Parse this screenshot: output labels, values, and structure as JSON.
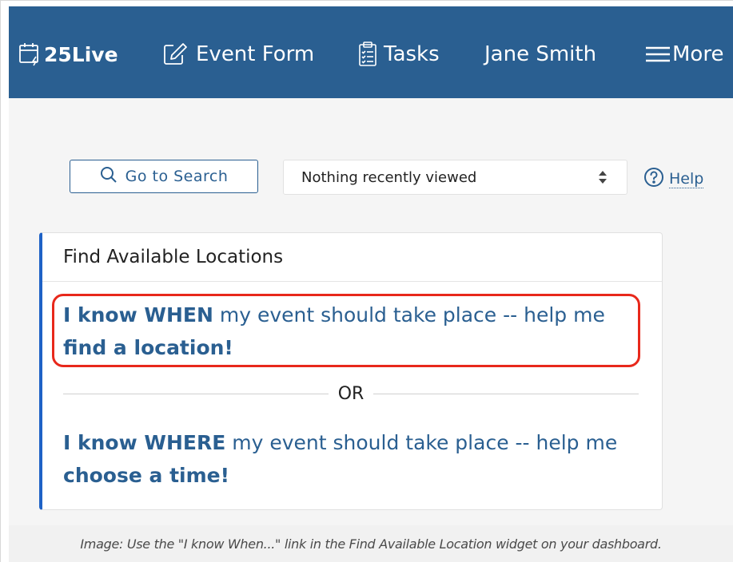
{
  "nav": {
    "brand": "25Live",
    "event_form": "Event Form",
    "tasks": "Tasks",
    "user": "Jane Smith",
    "more": "More",
    "icons": {
      "brand": "calendar-bolt-icon",
      "event_form": "edit-icon",
      "tasks": "clipboard-checklist-icon",
      "more": "hamburger-menu-icon"
    }
  },
  "toolbar": {
    "search_button": "Go to Search",
    "recent_select": "Nothing recently viewed",
    "help": "Help"
  },
  "widget": {
    "title": "Find Available Locations",
    "when_option": {
      "bold_lead": "I know WHEN",
      "text": " my event should take place -- help me ",
      "bold_tail": "find a location!"
    },
    "separator": "OR",
    "where_option": {
      "bold_lead": "I know WHERE",
      "text": " my event should take place -- help me ",
      "bold_tail": "choose a time!"
    }
  },
  "caption": "Image: Use the \"I know When...\" link in the Find Available Location widget on your dashboard.",
  "colors": {
    "nav_background": "#2a5f91",
    "link": "#2a5f91",
    "widget_accent": "#1f62c6",
    "highlight": "#e8281b"
  }
}
